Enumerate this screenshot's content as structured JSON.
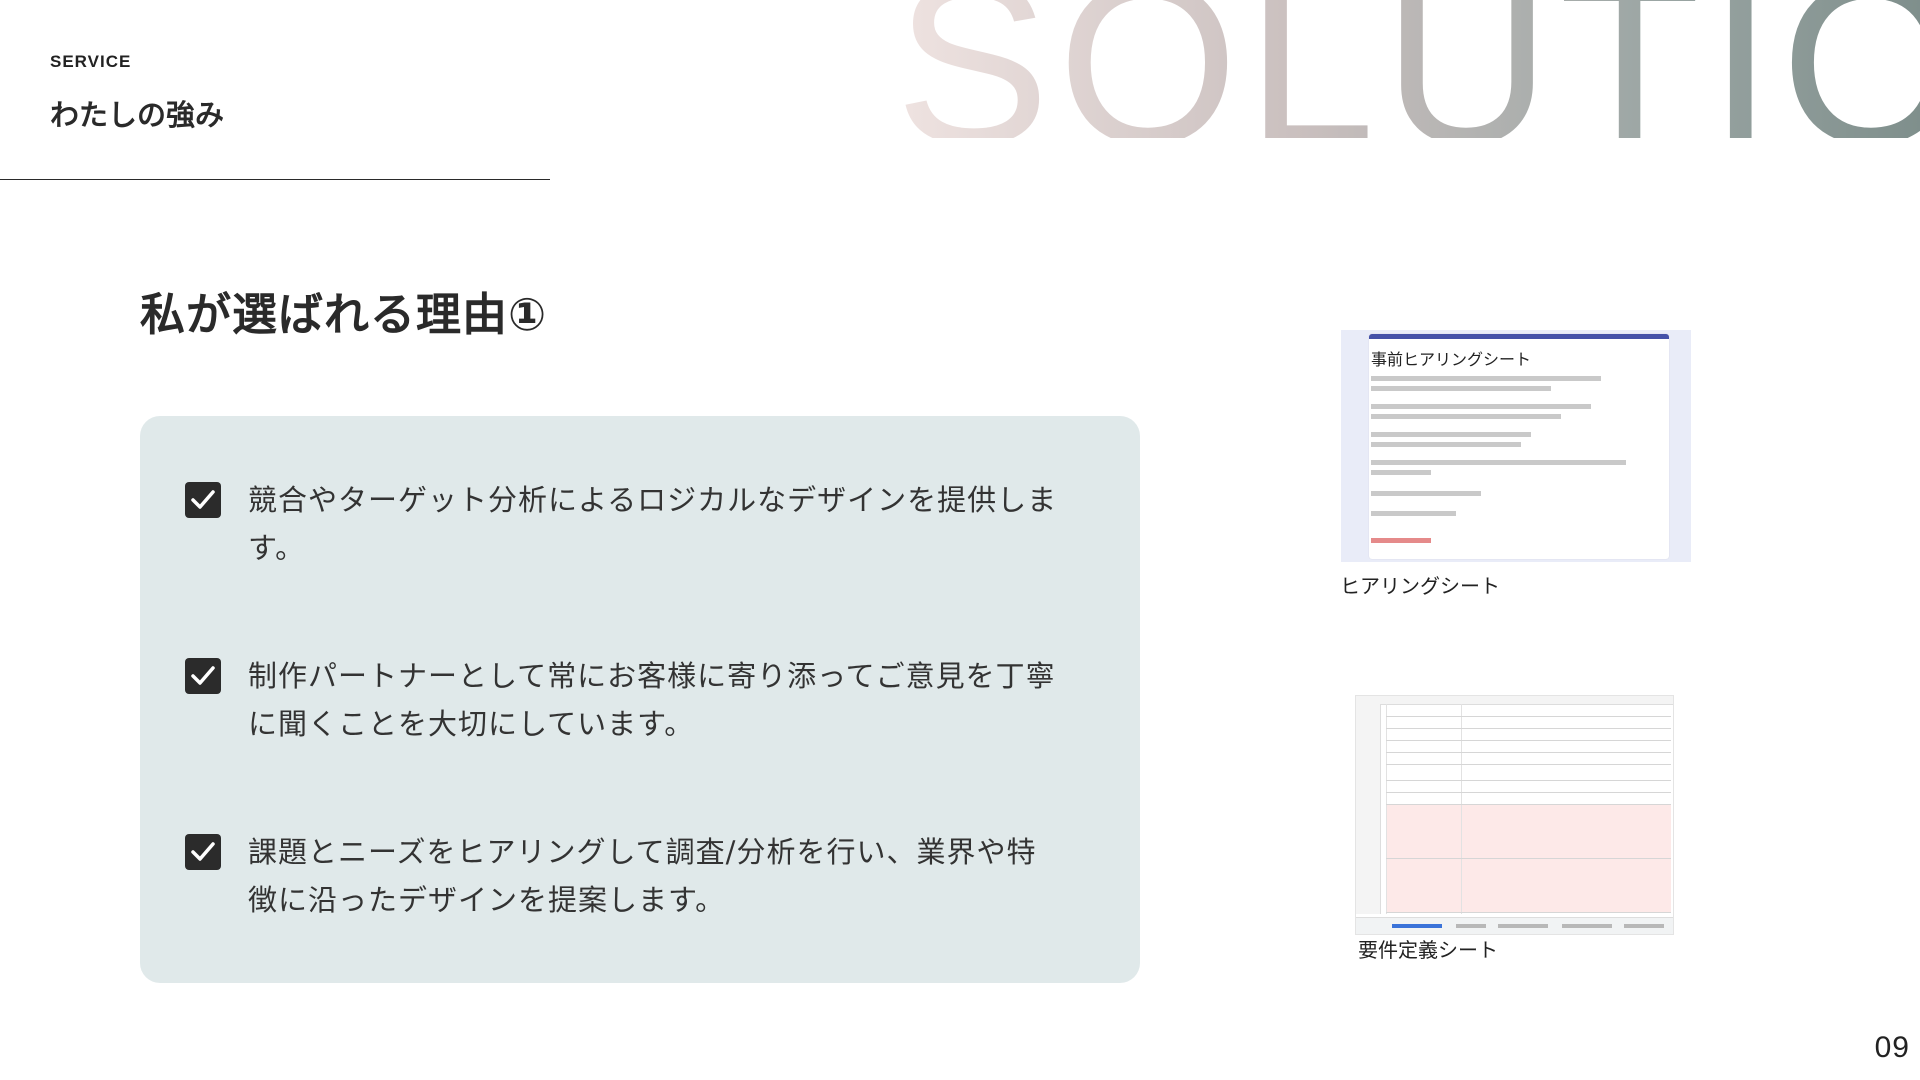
{
  "hero": {
    "word": "SOLUTION"
  },
  "header": {
    "eyebrow": "SERVICE",
    "title": "わたしの強み"
  },
  "heading": "私が選ばれる理由①",
  "reasons": [
    {
      "text": "競合やターゲット分析によるロジカルなデザインを提供します。"
    },
    {
      "text": "制作パートナーとして常にお客様に寄り添ってご意見を丁寧に聞くことを大切にしています。"
    },
    {
      "text": "課題とニーズをヒアリングして調査/分析を行い、業界や特徴に沿ったデザインを提案します。"
    }
  ],
  "thumbnails": {
    "hearing": {
      "doc_title": "事前ヒアリングシート",
      "caption": "ヒアリングシート"
    },
    "requirements": {
      "caption": "要件定義シート"
    }
  },
  "page_number": "09",
  "colors": {
    "panel": "#e0e9ea",
    "checkbox": "#2b2b2b",
    "form_accent": "#4552a8"
  }
}
